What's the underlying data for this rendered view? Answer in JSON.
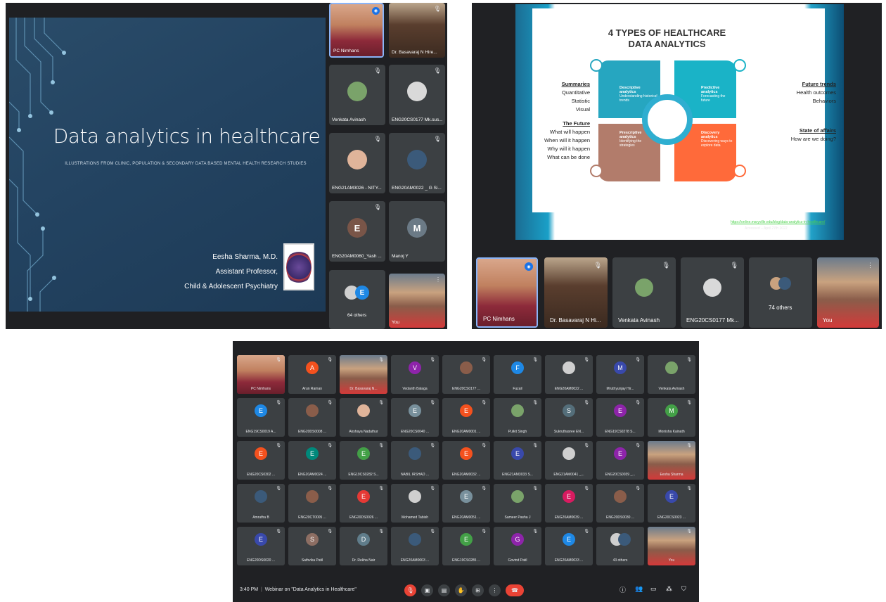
{
  "panel1": {
    "slide": {
      "title": "Data analytics in healthcare",
      "subtitle": "ILLUSTRATIONS FROM CLINIC, POPULATION & SECONDARY DATA BASED MENTAL HEALTH RESEARCH STUDIES",
      "author_name": "Eesha Sharma, M.D.",
      "author_role": "Assistant Professor,",
      "author_dept": "Child & Adolescent Psychiatry"
    },
    "tiles": [
      {
        "name": "PC Nimhans"
      },
      {
        "name": "Dr. Basavaraj N Hire..."
      },
      {
        "name": "Venkata Avinash"
      },
      {
        "name": "ENG20CS0177 Mk.sus..."
      },
      {
        "name": "ENG21AM3026 - NITY..."
      },
      {
        "name": "ENG20AM0022 _ G Si..."
      },
      {
        "name": "ENG20AM0060_Yash ...",
        "initial": "E"
      },
      {
        "name": "Manoj Y",
        "initial": "M"
      },
      {
        "name": "64 others",
        "initial": "E"
      },
      {
        "name": "You"
      }
    ]
  },
  "panel2": {
    "slide": {
      "title_line1": "4 TYPES OF HEALTHCARE",
      "title_line2": "DATA ANALYTICS",
      "left_head1": "Summaries",
      "left_items1": [
        "Quantitative",
        "Statistic",
        "Visual"
      ],
      "left_head2": "The Future",
      "left_items2": [
        "What will happen",
        "When will it happen",
        "Why will it happen",
        "What can be done"
      ],
      "right_head1": "Future trends",
      "right_items1": [
        "Health outcomes",
        "Behaviors"
      ],
      "right_head2": "State of affairs",
      "right_items2": [
        "How are we doing?"
      ],
      "q1_title": "Descriptive analytics",
      "q1_text": "Understanding historical trends",
      "q2_title": "Predictive analytics",
      "q2_text": "Forecasting the future",
      "q3_title": "Prescriptive analytics",
      "q3_text": "Identifying the strategies",
      "q4_title": "Discovery analytics",
      "q4_text": "Discovering ways to explore data",
      "link": "https://online.maryville.edu/blog/data-analytics-in-healthcare/",
      "accessed": "Accessed – April 27th 2022"
    },
    "strip": [
      {
        "name": "PC Nimhans"
      },
      {
        "name": "Dr. Basavaraj N Hi..."
      },
      {
        "name": "Venkata Avinash"
      },
      {
        "name": "ENG20CS0177 Mk..."
      },
      {
        "name": "74 others"
      },
      {
        "name": "You"
      }
    ]
  },
  "panel3": {
    "grid": [
      {
        "name": "PC Nimhans",
        "kind": "photo"
      },
      {
        "name": "Arun Raman",
        "initial": "A",
        "color": "#f4511e"
      },
      {
        "name": "Dr. Basavaraj N...",
        "kind": "photo"
      },
      {
        "name": "Vedanth Balaga",
        "initial": "V",
        "color": "#8e24aa"
      },
      {
        "name": "ENG20CS0177 ...",
        "kind": "pic"
      },
      {
        "name": "Fuzail",
        "initial": "F",
        "color": "#1e88e5"
      },
      {
        "name": "ENG20AM0022 ...",
        "kind": "pic"
      },
      {
        "name": "Mruthyunjay Hir...",
        "initial": "M",
        "color": "#3949ab"
      },
      {
        "name": "Venkata Avinash",
        "kind": "pic"
      },
      {
        "name": "ENG19CS0019 A...",
        "initial": "E",
        "color": "#1e88e5"
      },
      {
        "name": "ENG20DS0008 ...",
        "kind": "pic"
      },
      {
        "name": "Akshaya Nadathur",
        "kind": "pic"
      },
      {
        "name": "ENG20CS0040 ...",
        "initial": "E",
        "color": "#78909c"
      },
      {
        "name": "ENG20AM0001 ...",
        "initial": "E",
        "color": "#f4511e"
      },
      {
        "name": "Pulkit Singh",
        "kind": "pic"
      },
      {
        "name": "Sukruthasree EN...",
        "initial": "S",
        "color": "#546e7a"
      },
      {
        "name": "ENG19CS0278 S...",
        "initial": "E",
        "color": "#8e24aa"
      },
      {
        "name": "Monisha Kainath",
        "initial": "M",
        "color": "#43a047"
      },
      {
        "name": "ENG20CS0302 ...",
        "initial": "E",
        "color": "#f4511e"
      },
      {
        "name": "ENG20AM0024 ...",
        "initial": "E",
        "color": "#00897b"
      },
      {
        "name": "ENG19CS0282 S...",
        "initial": "E",
        "color": "#43a047"
      },
      {
        "name": "NABIL IRSHAD ...",
        "kind": "pic"
      },
      {
        "name": "ENG20AM0032 ...",
        "initial": "E",
        "color": "#f4511e"
      },
      {
        "name": "ENG21AM3033 S...",
        "initial": "E",
        "color": "#3949ab"
      },
      {
        "name": "ENG21AM0041 _...",
        "kind": "pic"
      },
      {
        "name": "ENG20CS0039 _...",
        "initial": "E",
        "color": "#8e24aa"
      },
      {
        "name": "Eesha Sharma",
        "kind": "photo"
      },
      {
        "name": "Amrutha B",
        "kind": "pic"
      },
      {
        "name": "ENG20CT0005 ...",
        "kind": "pic"
      },
      {
        "name": "ENG20DS0026 ...",
        "initial": "E",
        "color": "#e53935"
      },
      {
        "name": "Mohamed Tabish",
        "kind": "pic"
      },
      {
        "name": "ENG20AM0051 ...",
        "initial": "E",
        "color": "#78909c"
      },
      {
        "name": "Sameer Pasha J",
        "kind": "pic"
      },
      {
        "name": "ENG20AM0039 ...",
        "initial": "E",
        "color": "#d81b60"
      },
      {
        "name": "ENG20DS0030 ...",
        "kind": "pic"
      },
      {
        "name": "ENG20CS0023 ...",
        "initial": "E",
        "color": "#3949ab"
      },
      {
        "name": "ENG20DS0020 ...",
        "initial": "E",
        "color": "#3949ab"
      },
      {
        "name": "Sathvika Patil",
        "initial": "S",
        "color": "#8d6e63"
      },
      {
        "name": "Dr. Rekha Nair",
        "initial": "D",
        "color": "#607d8b"
      },
      {
        "name": "ENG20AM0003 ...",
        "kind": "pic"
      },
      {
        "name": "ENG19CS0285 ...",
        "initial": "E",
        "color": "#43a047"
      },
      {
        "name": "Govind Patil",
        "initial": "G",
        "color": "#8e24aa"
      },
      {
        "name": "ENG20AM0033 ...",
        "initial": "E",
        "color": "#1e88e5"
      },
      {
        "name": "43 others",
        "kind": "others"
      },
      {
        "name": "You",
        "kind": "photo"
      }
    ],
    "meeting_time": "3:40 PM",
    "meeting_title": "Webinar on \"Data Analytics in Healthcare\""
  }
}
